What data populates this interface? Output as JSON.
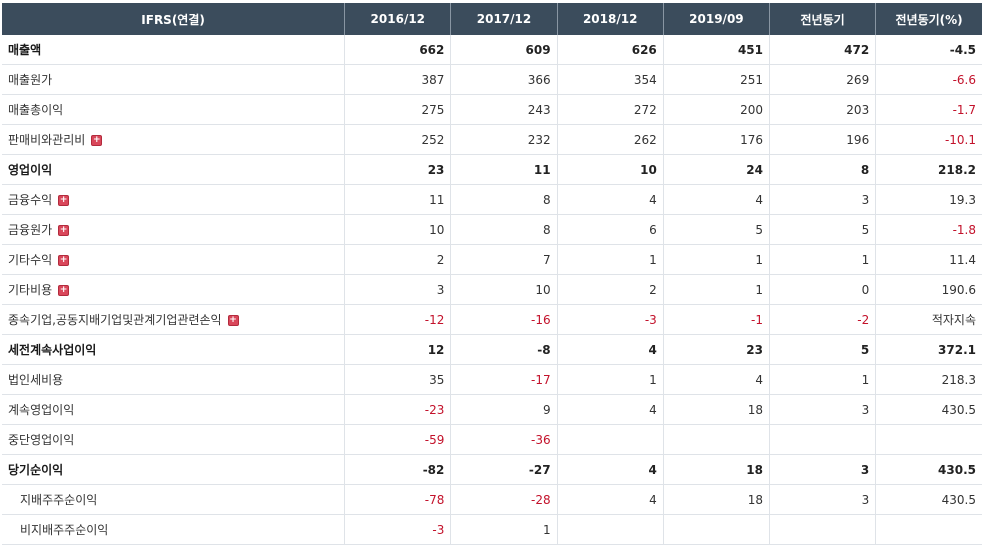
{
  "header": [
    "IFRS(연결)",
    "2016/12",
    "2017/12",
    "2018/12",
    "2019/09",
    "전년동기",
    "전년동기(%)"
  ],
  "rows": [
    {
      "label": "매출액",
      "major": true,
      "expand": false,
      "indent": false,
      "values": [
        "662",
        "609",
        "626",
        "451",
        "472",
        "-4.5"
      ]
    },
    {
      "label": "매출원가",
      "major": false,
      "expand": false,
      "indent": false,
      "values": [
        "387",
        "366",
        "354",
        "251",
        "269",
        "-6.6"
      ]
    },
    {
      "label": "매출총이익",
      "major": false,
      "expand": false,
      "indent": false,
      "values": [
        "275",
        "243",
        "272",
        "200",
        "203",
        "-1.7"
      ]
    },
    {
      "label": "판매비와관리비",
      "major": false,
      "expand": true,
      "indent": false,
      "values": [
        "252",
        "232",
        "262",
        "176",
        "196",
        "-10.1"
      ]
    },
    {
      "label": "영업이익",
      "major": true,
      "expand": false,
      "indent": false,
      "values": [
        "23",
        "11",
        "10",
        "24",
        "8",
        "218.2"
      ]
    },
    {
      "label": "금융수익",
      "major": false,
      "expand": true,
      "indent": false,
      "values": [
        "11",
        "8",
        "4",
        "4",
        "3",
        "19.3"
      ]
    },
    {
      "label": "금융원가",
      "major": false,
      "expand": true,
      "indent": false,
      "values": [
        "10",
        "8",
        "6",
        "5",
        "5",
        "-1.8"
      ]
    },
    {
      "label": "기타수익",
      "major": false,
      "expand": true,
      "indent": false,
      "values": [
        "2",
        "7",
        "1",
        "1",
        "1",
        "11.4"
      ]
    },
    {
      "label": "기타비용",
      "major": false,
      "expand": true,
      "indent": false,
      "values": [
        "3",
        "10",
        "2",
        "1",
        "0",
        "190.6"
      ]
    },
    {
      "label": "종속기업,공동지배기업및관계기업관련손익",
      "major": false,
      "expand": true,
      "indent": false,
      "values": [
        "-12",
        "-16",
        "-3",
        "-1",
        "-2",
        "적자지속"
      ]
    },
    {
      "label": "세전계속사업이익",
      "major": true,
      "expand": false,
      "indent": false,
      "values": [
        "12",
        "-8",
        "4",
        "23",
        "5",
        "372.1"
      ]
    },
    {
      "label": "법인세비용",
      "major": false,
      "expand": false,
      "indent": false,
      "values": [
        "35",
        "-17",
        "1",
        "4",
        "1",
        "218.3"
      ]
    },
    {
      "label": "계속영업이익",
      "major": false,
      "expand": false,
      "indent": false,
      "values": [
        "-23",
        "9",
        "4",
        "18",
        "3",
        "430.5"
      ]
    },
    {
      "label": "중단영업이익",
      "major": false,
      "expand": false,
      "indent": false,
      "values": [
        "-59",
        "-36",
        "",
        "",
        "",
        ""
      ]
    },
    {
      "label": "당기순이익",
      "major": true,
      "expand": false,
      "indent": false,
      "values": [
        "-82",
        "-27",
        "4",
        "18",
        "3",
        "430.5"
      ]
    },
    {
      "label": "지배주주순이익",
      "major": false,
      "expand": false,
      "indent": true,
      "values": [
        "-78",
        "-28",
        "4",
        "18",
        "3",
        "430.5"
      ]
    },
    {
      "label": "비지배주주순이익",
      "major": false,
      "expand": false,
      "indent": true,
      "values": [
        "-3",
        "1",
        "",
        "",
        "",
        ""
      ]
    }
  ],
  "icons": {
    "expand": "plus-icon"
  },
  "colors": {
    "header_bg": "#3b4c5c",
    "negative": "#c3122b",
    "expand_icon": "#d9475a"
  },
  "expand_glyph": "+"
}
